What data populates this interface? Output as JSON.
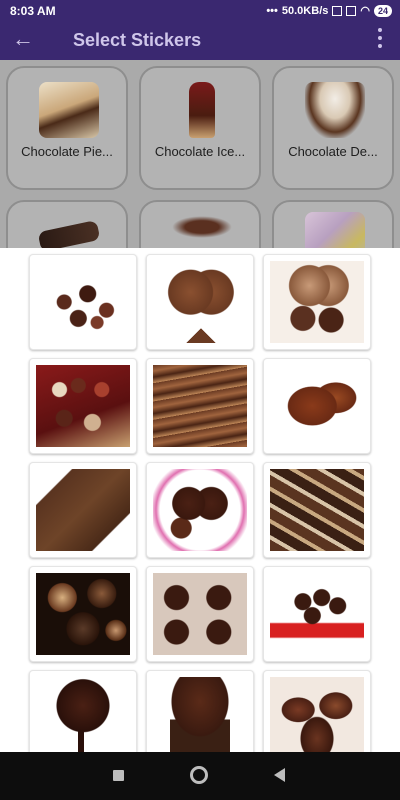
{
  "status": {
    "time": "8:03 AM",
    "network": "50.0KB/s",
    "battery": "24"
  },
  "appbar": {
    "title": "Select Stickers"
  },
  "packs": [
    {
      "label": "Chocolate Pie..."
    },
    {
      "label": "Chocolate Ice..."
    },
    {
      "label": "Chocolate De..."
    },
    {
      "label": ""
    },
    {
      "label": ""
    },
    {
      "label": ""
    }
  ],
  "stickers": [
    {
      "name": "truffle-assortment-sticker"
    },
    {
      "name": "chocolate-heart-ribbon-sticker"
    },
    {
      "name": "love-chocolate-hearts-sticker"
    },
    {
      "name": "chocolate-box-sticker"
    },
    {
      "name": "melted-chocolate-sticker"
    },
    {
      "name": "heart-bonbons-sticker"
    },
    {
      "name": "chocolate-bar-piece-sticker"
    },
    {
      "name": "chocolate-hearts-plate-sticker"
    },
    {
      "name": "chocolate-pieces-pile-sticker"
    },
    {
      "name": "glazed-truffles-sticker"
    },
    {
      "name": "heart-chocolate-mold-sticker"
    },
    {
      "name": "cupcakes-cake-stand-sticker"
    },
    {
      "name": "chocolate-rose-sticker"
    },
    {
      "name": "chocolate-cupcake-sticker"
    },
    {
      "name": "chocolate-pralines-sticker"
    }
  ]
}
